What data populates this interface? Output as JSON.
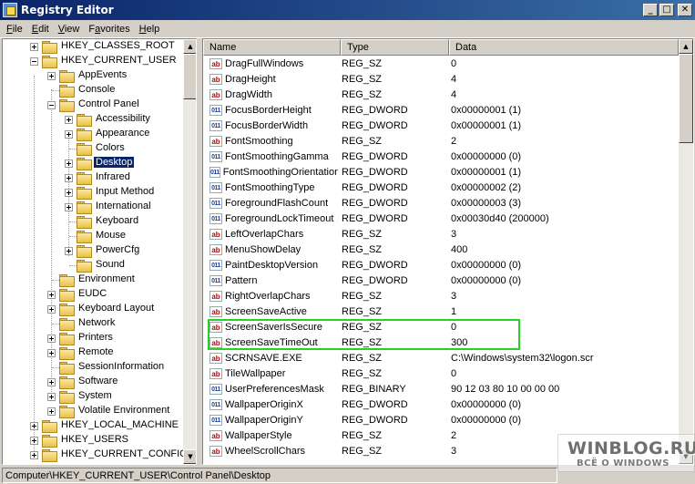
{
  "window": {
    "title": "Registry Editor",
    "buttons": {
      "minimize": "_",
      "maximize": "□",
      "close": "✕"
    }
  },
  "menu": [
    {
      "pre": "",
      "u": "F",
      "post": "ile"
    },
    {
      "pre": "",
      "u": "E",
      "post": "dit"
    },
    {
      "pre": "",
      "u": "V",
      "post": "iew"
    },
    {
      "pre": "F",
      "u": "a",
      "post": "vorites"
    },
    {
      "pre": "",
      "u": "H",
      "post": "elp"
    }
  ],
  "tree": [
    {
      "label": "HKEY_CLASSES_ROOT",
      "level": 0,
      "expander": "plus"
    },
    {
      "label": "HKEY_CURRENT_USER",
      "level": 0,
      "expander": "minus"
    },
    {
      "label": "AppEvents",
      "level": 1,
      "expander": "plus"
    },
    {
      "label": "Console",
      "level": 1,
      "expander": "none"
    },
    {
      "label": "Control Panel",
      "level": 1,
      "expander": "minus"
    },
    {
      "label": "Accessibility",
      "level": 2,
      "expander": "plus"
    },
    {
      "label": "Appearance",
      "level": 2,
      "expander": "plus"
    },
    {
      "label": "Colors",
      "level": 2,
      "expander": "none"
    },
    {
      "label": "Desktop",
      "level": 2,
      "expander": "plus",
      "selected": true
    },
    {
      "label": "Infrared",
      "level": 2,
      "expander": "plus"
    },
    {
      "label": "Input Method",
      "level": 2,
      "expander": "plus"
    },
    {
      "label": "International",
      "level": 2,
      "expander": "plus"
    },
    {
      "label": "Keyboard",
      "level": 2,
      "expander": "none"
    },
    {
      "label": "Mouse",
      "level": 2,
      "expander": "none"
    },
    {
      "label": "PowerCfg",
      "level": 2,
      "expander": "plus"
    },
    {
      "label": "Sound",
      "level": 2,
      "expander": "none"
    },
    {
      "label": "Environment",
      "level": 1,
      "expander": "none"
    },
    {
      "label": "EUDC",
      "level": 1,
      "expander": "plus"
    },
    {
      "label": "Keyboard Layout",
      "level": 1,
      "expander": "plus"
    },
    {
      "label": "Network",
      "level": 1,
      "expander": "none"
    },
    {
      "label": "Printers",
      "level": 1,
      "expander": "plus"
    },
    {
      "label": "Remote",
      "level": 1,
      "expander": "plus"
    },
    {
      "label": "SessionInformation",
      "level": 1,
      "expander": "none"
    },
    {
      "label": "Software",
      "level": 1,
      "expander": "plus"
    },
    {
      "label": "System",
      "level": 1,
      "expander": "plus"
    },
    {
      "label": "Volatile Environment",
      "level": 1,
      "expander": "plus"
    },
    {
      "label": "HKEY_LOCAL_MACHINE",
      "level": 0,
      "expander": "plus"
    },
    {
      "label": "HKEY_USERS",
      "level": 0,
      "expander": "plus"
    },
    {
      "label": "HKEY_CURRENT_CONFIG",
      "level": 0,
      "expander": "plus"
    }
  ],
  "list": {
    "columns": [
      "Name",
      "Type",
      "Data"
    ],
    "rows": [
      {
        "icon": "ab",
        "name": "DragFullWindows",
        "type": "REG_SZ",
        "data": "0"
      },
      {
        "icon": "ab",
        "name": "DragHeight",
        "type": "REG_SZ",
        "data": "4"
      },
      {
        "icon": "ab",
        "name": "DragWidth",
        "type": "REG_SZ",
        "data": "4"
      },
      {
        "icon": "bin",
        "name": "FocusBorderHeight",
        "type": "REG_DWORD",
        "data": "0x00000001 (1)"
      },
      {
        "icon": "bin",
        "name": "FocusBorderWidth",
        "type": "REG_DWORD",
        "data": "0x00000001 (1)"
      },
      {
        "icon": "ab",
        "name": "FontSmoothing",
        "type": "REG_SZ",
        "data": "2"
      },
      {
        "icon": "bin",
        "name": "FontSmoothingGamma",
        "type": "REG_DWORD",
        "data": "0x00000000 (0)"
      },
      {
        "icon": "bin",
        "name": "FontSmoothingOrientation",
        "type": "REG_DWORD",
        "data": "0x00000001 (1)"
      },
      {
        "icon": "bin",
        "name": "FontSmoothingType",
        "type": "REG_DWORD",
        "data": "0x00000002 (2)"
      },
      {
        "icon": "bin",
        "name": "ForegroundFlashCount",
        "type": "REG_DWORD",
        "data": "0x00000003 (3)"
      },
      {
        "icon": "bin",
        "name": "ForegroundLockTimeout",
        "type": "REG_DWORD",
        "data": "0x00030d40 (200000)"
      },
      {
        "icon": "ab",
        "name": "LeftOverlapChars",
        "type": "REG_SZ",
        "data": "3"
      },
      {
        "icon": "ab",
        "name": "MenuShowDelay",
        "type": "REG_SZ",
        "data": "400"
      },
      {
        "icon": "bin",
        "name": "PaintDesktopVersion",
        "type": "REG_DWORD",
        "data": "0x00000000 (0)"
      },
      {
        "icon": "bin",
        "name": "Pattern",
        "type": "REG_DWORD",
        "data": "0x00000000 (0)"
      },
      {
        "icon": "ab",
        "name": "RightOverlapChars",
        "type": "REG_SZ",
        "data": "3"
      },
      {
        "icon": "ab",
        "name": "ScreenSaveActive",
        "type": "REG_SZ",
        "data": "1"
      },
      {
        "icon": "ab",
        "name": "ScreenSaverIsSecure",
        "type": "REG_SZ",
        "data": "0"
      },
      {
        "icon": "ab",
        "name": "ScreenSaveTimeOut",
        "type": "REG_SZ",
        "data": "300"
      },
      {
        "icon": "ab",
        "name": "SCRNSAVE.EXE",
        "type": "REG_SZ",
        "data": "C:\\Windows\\system32\\logon.scr"
      },
      {
        "icon": "ab",
        "name": "TileWallpaper",
        "type": "REG_SZ",
        "data": "0"
      },
      {
        "icon": "bin",
        "name": "UserPreferencesMask",
        "type": "REG_BINARY",
        "data": "90 12 03 80 10 00 00 00"
      },
      {
        "icon": "bin",
        "name": "WallpaperOriginX",
        "type": "REG_DWORD",
        "data": "0x00000000 (0)"
      },
      {
        "icon": "bin",
        "name": "WallpaperOriginY",
        "type": "REG_DWORD",
        "data": "0x00000000 (0)"
      },
      {
        "icon": "ab",
        "name": "WallpaperStyle",
        "type": "REG_SZ",
        "data": "2"
      },
      {
        "icon": "ab",
        "name": "WheelScrollChars",
        "type": "REG_SZ",
        "data": "3"
      }
    ],
    "highlight_color": "#28d128"
  },
  "icons": {
    "string_value": "ab",
    "binary_value": "011"
  },
  "statusbar": {
    "path": "Computer\\HKEY_CURRENT_USER\\Control Panel\\Desktop"
  },
  "watermark": {
    "line1": "WINBLOG.RU",
    "line2": "ВСЁ О WINDOWS"
  },
  "scrollbar_arrows": {
    "up": "▲",
    "down": "▼"
  }
}
